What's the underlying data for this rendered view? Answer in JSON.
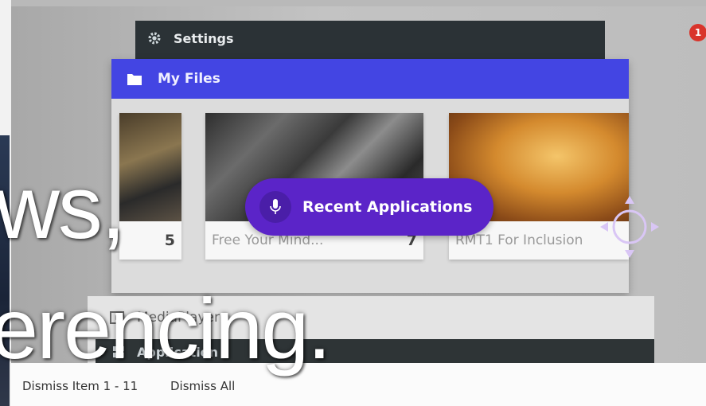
{
  "notification": {
    "count": "1"
  },
  "settings_window": {
    "title": "Settings",
    "icon": "gear-icon"
  },
  "files_window": {
    "title": "My Files",
    "icon": "folder-icon",
    "cards": [
      {
        "caption": "",
        "count": "5"
      },
      {
        "caption": "Free Your Mind...",
        "count": "7"
      },
      {
        "caption": "RMT1 For Inclusion",
        "count": ""
      }
    ]
  },
  "voice_tooltip": {
    "label": "Recent Applications",
    "icon": "microphone-icon"
  },
  "media_window": {
    "title": "MediaPlayer",
    "bar_label": "Application"
  },
  "dismiss": {
    "item_label": "Dismiss Item 1 - 11",
    "all_label": "Dismiss All"
  },
  "caption_overlay": {
    "line1": "ws,",
    "line2": "erencing."
  },
  "colors": {
    "files_header": "#4345e3",
    "voice_pill": "#5b24c8",
    "settings_header": "#2b3236",
    "badge": "#d9342b"
  }
}
